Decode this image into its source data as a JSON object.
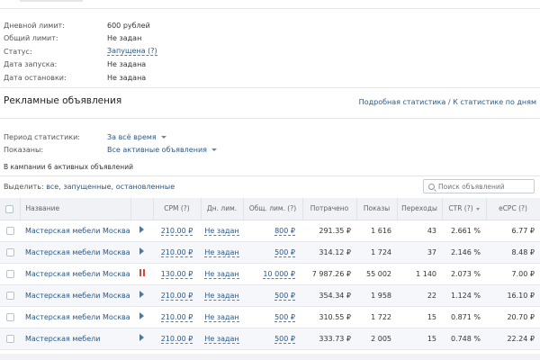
{
  "info": [
    {
      "label": "Дневной лимит:",
      "value": "600 рублей",
      "style": "plain"
    },
    {
      "label": "Общий лимит:",
      "value": "Не задан",
      "style": "plain"
    },
    {
      "label": "Статус:",
      "value": "Запущена (?)",
      "style": "dotted"
    },
    {
      "label": "Дата запуска:",
      "value": "Не задана",
      "style": "plain"
    },
    {
      "label": "Дата остановки:",
      "value": "Не задана",
      "style": "plain"
    }
  ],
  "section": {
    "title": "Рекламные объявления",
    "link_detailed": "Подробная статистика",
    "link_separator": "/",
    "link_daily": "К статистике по дням"
  },
  "filters": {
    "period_label": "Период статистики:",
    "period_value": "За всё время",
    "shown_label": "Показаны:",
    "shown_value": "Все активные объявления"
  },
  "count_note": "В кампании 6 активных объявлений",
  "select": {
    "prefix": "Выделить:",
    "options": [
      "все",
      "запущенные",
      "остановленные"
    ]
  },
  "search": {
    "placeholder": "Поиск объявлений"
  },
  "table": {
    "headers": {
      "name": "Название",
      "cpm": "CPM (?)",
      "day": "Дн. лим.",
      "total": "Общ. лим. (?)",
      "spent": "Потрачено",
      "shows": "Показы",
      "clicks": "Переходы",
      "ctr": "CTR (?)",
      "ecpc": "eCPC (?)"
    },
    "rows": [
      {
        "name": "Мастерская мебели Москва",
        "status": "running",
        "cpm": "210.00 ₽",
        "day": "Не задан",
        "total": "800 ₽",
        "spent": "291.35 ₽",
        "shows": "1 616",
        "clicks": "43",
        "ctr": "2.661 %",
        "ecpc": "6.77 ₽"
      },
      {
        "name": "Мастерская мебели Москва",
        "status": "running",
        "cpm": "210.00 ₽",
        "day": "Не задан",
        "total": "500 ₽",
        "spent": "314.12 ₽",
        "shows": "1 724",
        "clicks": "37",
        "ctr": "2.146 %",
        "ecpc": "8.48 ₽"
      },
      {
        "name": "Мастерская мебели Москва",
        "status": "paused",
        "cpm": "130.00 ₽",
        "day": "Не задан",
        "total": "10 000 ₽",
        "spent": "7 987.26 ₽",
        "shows": "55 002",
        "clicks": "1 140",
        "ctr": "2.073 %",
        "ecpc": "7.00 ₽"
      },
      {
        "name": "Мастерская мебели Москва",
        "status": "running",
        "cpm": "210.00 ₽",
        "day": "Не задан",
        "total": "500 ₽",
        "spent": "354.34 ₽",
        "shows": "1 958",
        "clicks": "22",
        "ctr": "1.124 %",
        "ecpc": "16.10 ₽"
      },
      {
        "name": "Мастерская мебели Москва",
        "status": "running",
        "cpm": "210.00 ₽",
        "day": "Не задан",
        "total": "500 ₽",
        "spent": "310.55 ₽",
        "shows": "1 722",
        "clicks": "15",
        "ctr": "0.871 %",
        "ecpc": "20.70 ₽"
      },
      {
        "name": "Мастерская мебели",
        "status": "running",
        "cpm": "210.00 ₽",
        "day": "Не задан",
        "total": "500 ₽",
        "spent": "333.73 ₽",
        "shows": "2 005",
        "clicks": "15",
        "ctr": "0.748 %",
        "ecpc": "22.24 ₽"
      }
    ]
  },
  "colors": {
    "link": "#2a5885",
    "pause": "#d9453c",
    "play": "#4a76a8",
    "header_bg": "#f0f2f5"
  }
}
